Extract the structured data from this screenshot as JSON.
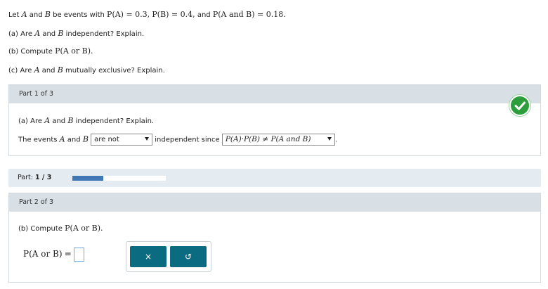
{
  "problem": {
    "intro_prefix": "Let",
    "var_a": "A",
    "and_word": "and",
    "var_b": "B",
    "intro_events": "be events with",
    "given_pa": "P(A) = 0.3,",
    "given_pb": "P(B) = 0.4,",
    "given_pab_prefix": "and",
    "given_pab": "P(A and B) = 0.18.",
    "q_a_prefix": "(a) Are",
    "q_a_suffix": "independent? Explain.",
    "q_b_prefix": "(b) Compute",
    "q_b_expr": "P(A or B).",
    "q_c_prefix": "(c) Are",
    "q_c_suffix": "mutually exclusive? Explain."
  },
  "part1": {
    "header": "Part 1 of 3",
    "question_prefix": "(a) Are",
    "question_suffix": "independent? Explain.",
    "answer_prefix": "The events",
    "dropdown1_value": "are not",
    "middle_text": "independent since",
    "dropdown2_value": "P(A)·P(B) ≠ P(A and B)",
    "status": "correct",
    "status_color": "#2e9e3c"
  },
  "progress": {
    "label": "Part:",
    "value_text": "1 / 3",
    "fraction": 0.333,
    "bar_color": "#3f78b5"
  },
  "part2": {
    "header": "Part 2 of 3",
    "question_prefix": "(b) Compute",
    "question_expr": "P(A or B).",
    "answer_lhs": "P(A or B)",
    "equals": "=",
    "answer_value": "",
    "clear_label": "×",
    "undo_label": "↺",
    "button_color": "#0b6b80"
  }
}
